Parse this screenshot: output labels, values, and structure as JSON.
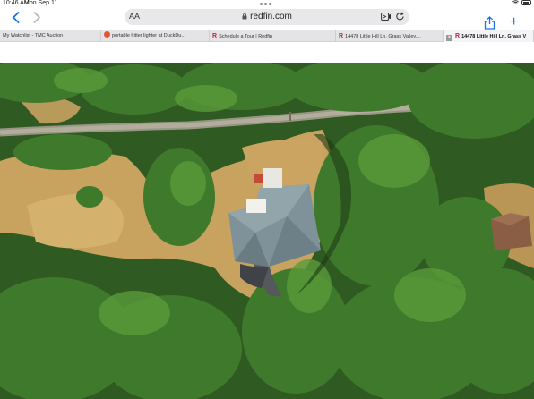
{
  "status_bar": {
    "time": "10:46 AM",
    "date": "Mon Sep 11"
  },
  "address_bar": {
    "reader_label": "AA",
    "url": "redfin.com"
  },
  "tabs": [
    {
      "label": "My Watchlist - TMC Auction",
      "favicon": "none"
    },
    {
      "label": "portable hitter lighter at DuckDu...",
      "favicon": "duckduckgo-icon"
    },
    {
      "label": "Schedule a Tour | Redfin",
      "favicon": "R"
    },
    {
      "label": "14478 Little Hill Ln, Grass Valley,...",
      "favicon": "R"
    },
    {
      "label": "14478 Little Hill Ln, Grass V",
      "favicon": "R",
      "active": true
    }
  ],
  "photo": {
    "subject": "aerial-property-photo"
  }
}
